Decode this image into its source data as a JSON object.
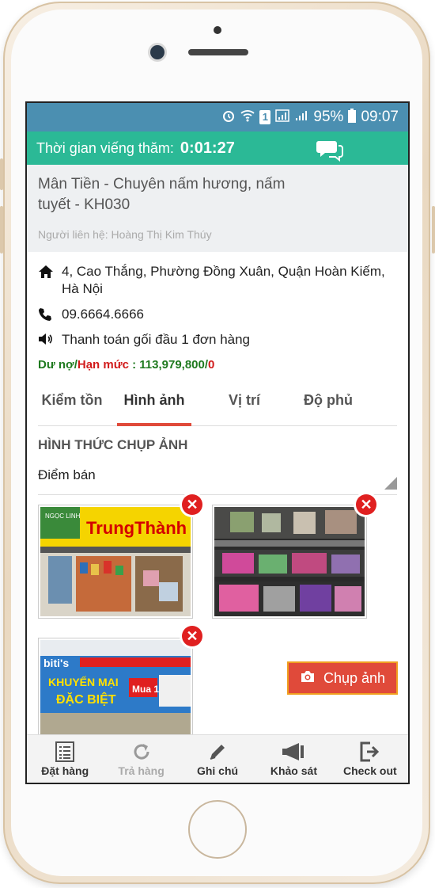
{
  "status_bar": {
    "alarm_icon": "alarm-icon",
    "wifi_icon": "wifi-icon",
    "sim_label": "1",
    "battery": "95%",
    "time": "09:07"
  },
  "visit": {
    "label": "Thời gian viếng thăm:",
    "time": "0:01:27"
  },
  "store": {
    "name": "Mân Tiền - Chuyên nấm hương, nấm tuyết - KH030",
    "contact": "Người liên hệ: Hoàng Thị Kim Thúy",
    "address": "4, Cao Thắng, Phường Đồng Xuân, Quận Hoàn Kiếm, Hà Nội",
    "phone": "09.6664.6666",
    "note": "Thanh toán gối đầu 1 đơn hàng",
    "debt_label": "Dư nợ",
    "limit_label": "Hạn mức",
    "separator": " : ",
    "debt_value": "113,979,800",
    "limit_value": "0"
  },
  "tabs": [
    {
      "label": "Kiểm tồn",
      "active": false
    },
    {
      "label": "Hình ảnh",
      "active": true
    },
    {
      "label": "Vị trí",
      "active": false
    },
    {
      "label": "Độ phủ",
      "active": false
    }
  ],
  "photo_section": {
    "title": "HÌNH THỨC CHỤP ẢNH",
    "selected_type": "Điểm bán",
    "capture_label": "Chụp ảnh",
    "photo1_sign": "TrungThành",
    "photo1_brand": "NGỌC LINH",
    "photo3_brand": "biti's",
    "photo3_line1": "KHUYẾN MẠI",
    "photo3_line2": "ĐẶC BIỆT",
    "photo3_badge": "Mua 1"
  },
  "bottom_nav": [
    {
      "label": "Đặt hàng",
      "icon": "list-icon",
      "enabled": true
    },
    {
      "label": "Trả hàng",
      "icon": "refresh-icon",
      "enabled": false
    },
    {
      "label": "Ghi chú",
      "icon": "pencil-icon",
      "enabled": true
    },
    {
      "label": "Khảo sát",
      "icon": "megaphone-icon",
      "enabled": true
    },
    {
      "label": "Check out",
      "icon": "logout-icon",
      "enabled": true
    }
  ],
  "colors": {
    "status_bar": "#4b8fb1",
    "visit_bar": "#2bb996",
    "accent": "#e04a3a",
    "debt_green": "#1f7a1f",
    "limit_red": "#d11a1a"
  }
}
